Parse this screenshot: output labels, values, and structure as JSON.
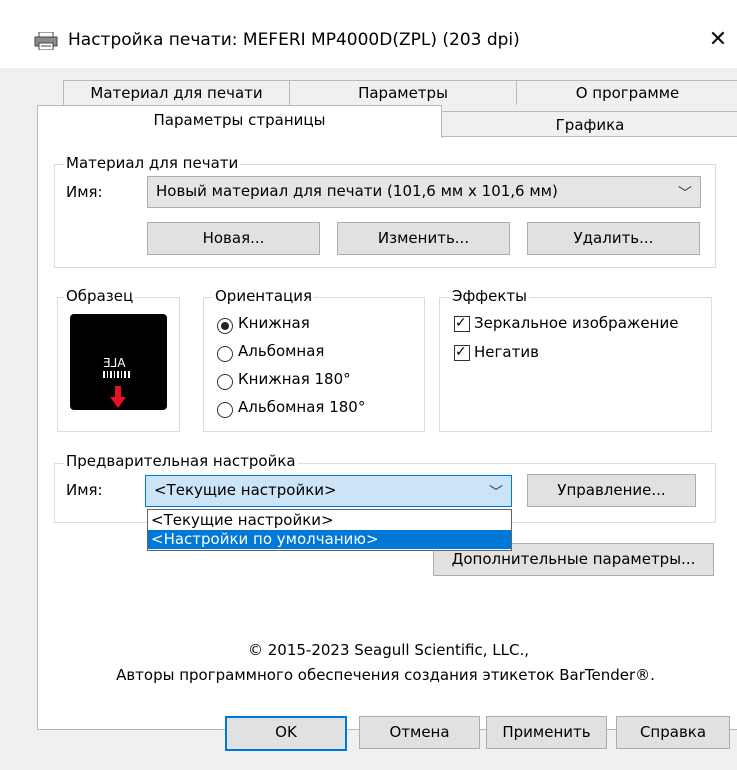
{
  "window": {
    "title": "Настройка печати: MEFERI MP4000D(ZPL) (203 dpi)",
    "close": "✕"
  },
  "tabs": {
    "row1": [
      "Материал для печати",
      "Параметры",
      "О программе"
    ],
    "row2": [
      "Параметры страницы",
      "Графика"
    ],
    "active": "Параметры страницы"
  },
  "media": {
    "group_label": "Материал для печати",
    "name_label": "Имя:",
    "selected": "Новый материал для печати (101,6 мм x 101,6 мм)",
    "new_btn": "Новая...",
    "edit_btn": "Изменить...",
    "delete_btn": "Удалить..."
  },
  "sample": {
    "group_label": "Образец",
    "preview_text": "ALE"
  },
  "orientation": {
    "group_label": "Ориентация",
    "options": [
      "Книжная",
      "Альбомная",
      "Книжная 180°",
      "Альбомная 180°"
    ],
    "selected_index": 0
  },
  "effects": {
    "group_label": "Эффекты",
    "options": [
      {
        "label": "Зеркальное изображение",
        "checked": true
      },
      {
        "label": "Негатив",
        "checked": true
      }
    ]
  },
  "preset": {
    "group_label": "Предварительная настройка",
    "name_label": "Имя:",
    "selected": "<Текущие настройки>",
    "manage_btn": "Управление...",
    "dropdown_options": [
      "<Текущие настройки>",
      "<Настройки по умолчанию>"
    ],
    "highlighted_index": 1
  },
  "advanced_btn": "Дополнительные параметры...",
  "copyright": {
    "line1": "© 2015-2023 Seagull Scientific, LLC.,",
    "line2": "Авторы программного обеспечения создания этикеток BarTender®."
  },
  "footer": {
    "ok": "OK",
    "cancel": "Отмена",
    "apply": "Применить",
    "help": "Справка"
  },
  "colors": {
    "accent": "#0078d7",
    "sample_arrow": "#e81123"
  }
}
